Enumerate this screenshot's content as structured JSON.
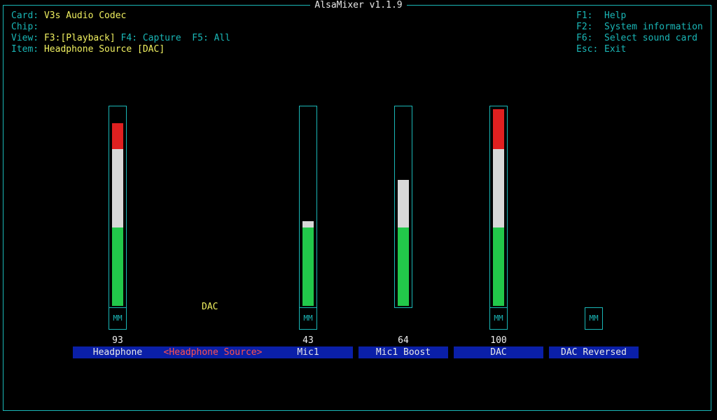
{
  "app": {
    "title": "AlsaMixer v1.1.9"
  },
  "info": {
    "card_label": "Card:",
    "card_value": "V3s Audio Codec",
    "chip_label": "Chip:",
    "chip_value": "",
    "view_label": "View:",
    "view_f3": "F3:[Playback]",
    "view_f4": "F4: Capture",
    "view_f5": "F5: All",
    "item_label": "Item:",
    "item_value": "Headphone Source [DAC]"
  },
  "help": [
    {
      "key": "F1:",
      "text": "Help"
    },
    {
      "key": "F2:",
      "text": "System information"
    },
    {
      "key": "F6:",
      "text": "Select sound card"
    },
    {
      "key": "Esc:",
      "text": "Exit"
    }
  ],
  "controls": [
    {
      "name": "Headphone",
      "value": "93",
      "level": 0.93,
      "mute": "MM"
    },
    {
      "name": "Headphone Source",
      "selected_display": "<Headphone Source>",
      "enum_value": "DAC"
    },
    {
      "name": "Mic1",
      "value": "43",
      "level": 0.43,
      "mute": "MM"
    },
    {
      "name": "Mic1 Boost",
      "value": "64",
      "level": 0.64
    },
    {
      "name": "DAC",
      "value": "100",
      "level": 1.0,
      "mute": "MM"
    },
    {
      "name": "DAC Reversed",
      "mute": "MM"
    }
  ],
  "colors": {
    "frame": "#1ab7b7",
    "green": "#22c84a",
    "white": "#d8d8d8",
    "red": "#e02020",
    "label_bg": "#0a1fa8"
  }
}
